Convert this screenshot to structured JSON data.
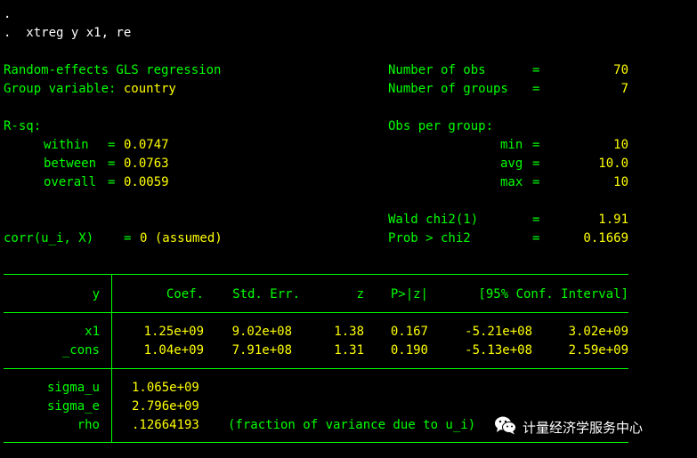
{
  "console": {
    "dot_line": ".",
    "command_line": ".  xtreg y x1, re"
  },
  "header": {
    "title": "Random-effects GLS regression",
    "group_var_label": "Group variable: ",
    "group_var_value": "country",
    "num_obs_label": "Number of obs",
    "num_obs_value": "70",
    "num_groups_label": "Number of groups",
    "num_groups_value": "7",
    "rsq_label": "R-sq:",
    "within_label": "within",
    "within_value": "0.0747",
    "between_label": "between",
    "between_value": "0.0763",
    "overall_label": "overall",
    "overall_value": "0.0059",
    "obs_per_group_label": "Obs per group:",
    "min_label": "min",
    "min_value": "10",
    "avg_label": "avg",
    "avg_value": "10.0",
    "max_label": "max",
    "max_value": "10",
    "wald_label": "Wald chi2(1)",
    "wald_value": "1.91",
    "corr_label": "corr(u_i, X)",
    "corr_value": "0 (assumed)",
    "prob_label": "Prob > chi2",
    "prob_value": "0.1669",
    "eq": "="
  },
  "table": {
    "headers": [
      "y",
      "Coef.",
      "Std. Err.",
      "z",
      "P>|z|",
      "[95% Conf. Interval]"
    ],
    "rows": [
      {
        "name": "x1",
        "coef": "1.25e+09",
        "se": "9.02e+08",
        "z": "1.38",
        "p": "0.167",
        "lo": "-5.21e+08",
        "hi": "3.02e+09"
      },
      {
        "name": "_cons",
        "coef": "1.04e+09",
        "se": "7.91e+08",
        "z": "1.31",
        "p": "0.190",
        "lo": "-5.13e+08",
        "hi": "2.59e+09"
      }
    ],
    "sigma_u_label": "sigma_u",
    "sigma_u_value": "1.065e+09",
    "sigma_e_label": "sigma_e",
    "sigma_e_value": "2.796e+09",
    "rho_label": "rho",
    "rho_value": ".12664193",
    "rho_note": "(fraction of variance due to u_i)"
  },
  "watermark": {
    "icon": "wechat-icon",
    "text": "计量经济学服务中心"
  }
}
